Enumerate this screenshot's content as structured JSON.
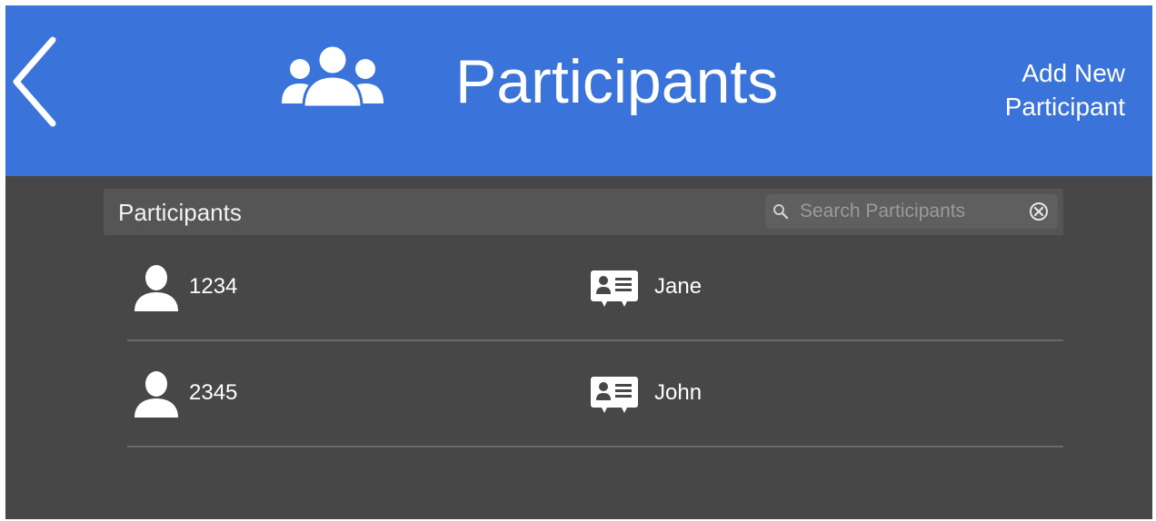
{
  "header": {
    "title": "Participants",
    "add_button_line1": "Add New",
    "add_button_line2": "Participant"
  },
  "list": {
    "header_title": "Participants",
    "search_placeholder": "Search Participants",
    "search_value": ""
  },
  "participants": [
    {
      "id": "1234",
      "name": "Jane"
    },
    {
      "id": "2345",
      "name": "John"
    }
  ],
  "colors": {
    "header_bg": "#3a73d9",
    "body_bg": "#474747",
    "list_header_bg": "#555555",
    "text": "#ffffff"
  },
  "icons": {
    "back": "chevron-left-icon",
    "group": "group-icon",
    "search": "search-icon",
    "clear": "clear-circle-icon",
    "person": "person-icon",
    "id_card": "id-card-icon"
  }
}
